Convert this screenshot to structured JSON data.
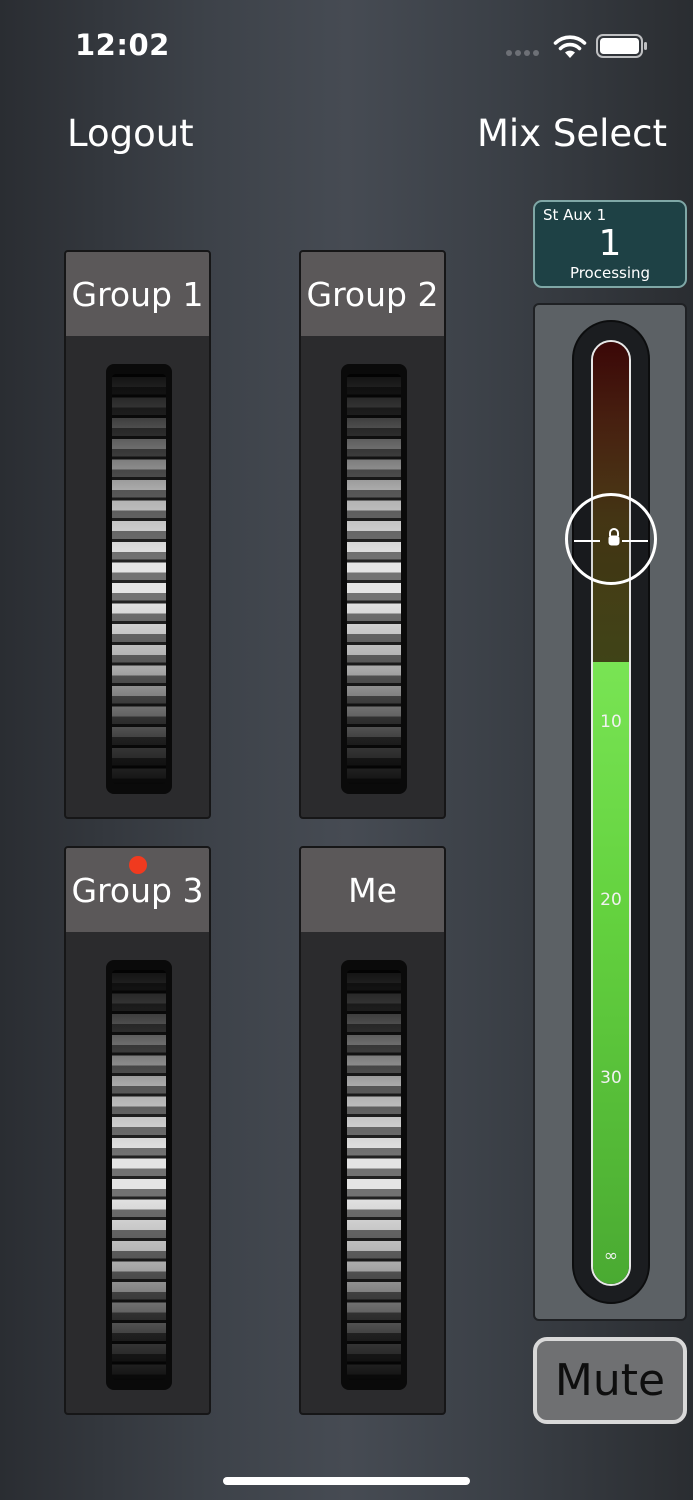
{
  "status_bar": {
    "time": "12:02",
    "wifi_icon": "wifi-icon",
    "battery_icon": "battery-icon"
  },
  "header": {
    "logout_label": "Logout",
    "mix_select_label": "Mix Select"
  },
  "groups": [
    {
      "label": "Group 1",
      "indicator": false
    },
    {
      "label": "Group 2",
      "indicator": false
    },
    {
      "label": "Group 3",
      "indicator": true,
      "indicator_color": "#f03a1f"
    },
    {
      "label": "Me",
      "indicator": false
    }
  ],
  "aux": {
    "name": "St Aux 1",
    "number": "1",
    "subtitle": "Processing"
  },
  "fader": {
    "scale_labels": [
      "10",
      "20",
      "30",
      "∞"
    ],
    "level_fraction": 0.66,
    "knob_fraction": 0.79,
    "locked": true,
    "lock_icon": "lock-icon"
  },
  "mute": {
    "label": "Mute"
  },
  "colors": {
    "group_header": "#5b5859",
    "aux_background": "#1e4145",
    "meter_green": "#64d23f",
    "indicator_red": "#f03a1f"
  }
}
